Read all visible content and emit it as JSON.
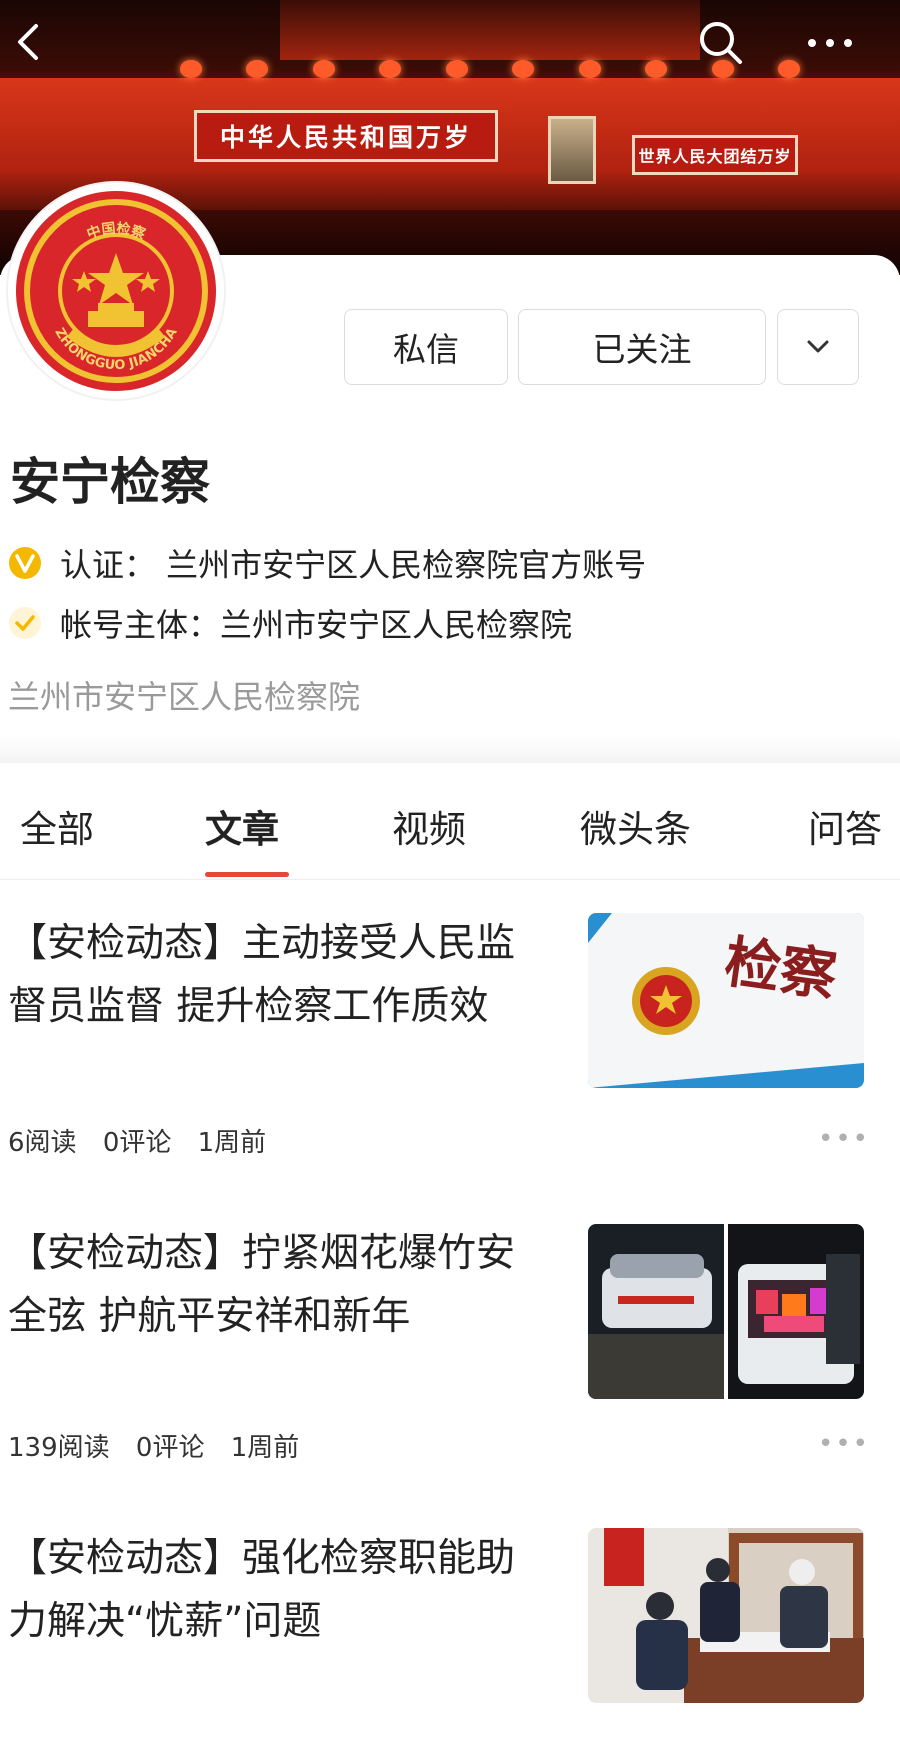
{
  "banner": {
    "slogan_left": "中华人民共和国万岁",
    "slogan_right": "世界人民大团结万岁"
  },
  "topbar": {
    "icons": [
      "back-icon",
      "search-icon",
      "more-icon"
    ]
  },
  "profile": {
    "avatar_text_top": "中国检察",
    "avatar_text_bottom": "ZHONGGUO JIANCHA",
    "name": "安宁检察",
    "buttons": {
      "message": "私信",
      "followed": "已关注"
    },
    "verification": "认证：  兰州市安宁区人民检察院官方账号",
    "account_owner": "帐号主体：兰州市安宁区人民检察院",
    "description": "兰州市安宁区人民检察院"
  },
  "tabs": [
    "全部",
    "文章",
    "视频",
    "微头条",
    "问答"
  ],
  "active_tab": "文章",
  "articles": [
    {
      "title": "【安检动态】主动接受人民监督员监督 提升检察工作质效",
      "reads": "6阅读",
      "comments": "0评论",
      "time": "1周前",
      "thumb_text": "检察"
    },
    {
      "title": "【安检动态】拧紧烟花爆竹安全弦 护航平安祥和新年",
      "reads": "139阅读",
      "comments": "0评论",
      "time": "1周前"
    },
    {
      "title": "【安检动态】强化检察职能助力解决“忧薪”问题",
      "reads": "",
      "comments": "",
      "time": ""
    }
  ],
  "colors": {
    "accent": "#e8453c",
    "verify": "#f5b800"
  }
}
